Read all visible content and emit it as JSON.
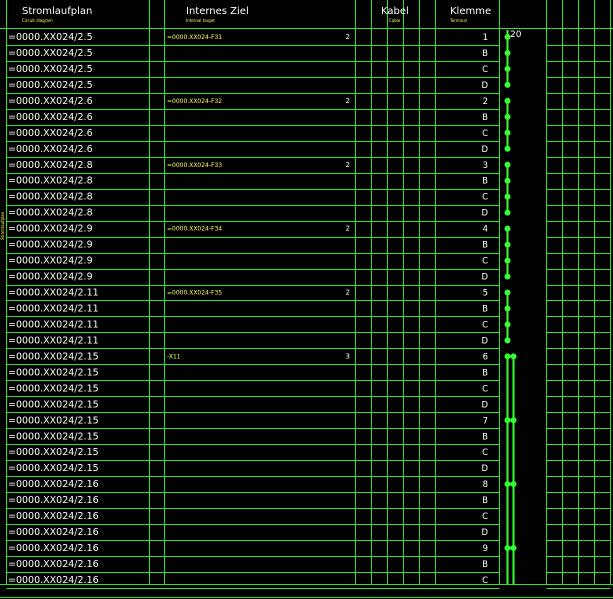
{
  "header": {
    "stromlaufplan": "Stromlaufplan",
    "stromlaufplan_sub": "Circuit diagram",
    "internes_ziel": "Internes Ziel",
    "internes_ziel_sub": "Internal target",
    "kabel": "Kabel",
    "kabel_sub": "Cable",
    "klemme": "Klemme",
    "klemme_sub": "Terminal",
    "bus_label": "20"
  },
  "side_label": "Stromlaufplan",
  "rows": [
    {
      "ref": "=0000.XX024/2.5",
      "target": "=0000.XX024-F31",
      "num": "2",
      "terminal": "1"
    },
    {
      "ref": "=0000.XX024/2.5",
      "target": "",
      "num": "",
      "terminal": "B"
    },
    {
      "ref": "=0000.XX024/2.5",
      "target": "",
      "num": "",
      "terminal": "C"
    },
    {
      "ref": "=0000.XX024/2.5",
      "target": "",
      "num": "",
      "terminal": "D"
    },
    {
      "ref": "=0000.XX024/2.6",
      "target": "=0000.XX024-F32",
      "num": "2",
      "terminal": "2"
    },
    {
      "ref": "=0000.XX024/2.6",
      "target": "",
      "num": "",
      "terminal": "B"
    },
    {
      "ref": "=0000.XX024/2.6",
      "target": "",
      "num": "",
      "terminal": "C"
    },
    {
      "ref": "=0000.XX024/2.6",
      "target": "",
      "num": "",
      "terminal": "D"
    },
    {
      "ref": "=0000.XX024/2.8",
      "target": "=0000.XX024-F33",
      "num": "2",
      "terminal": "3"
    },
    {
      "ref": "=0000.XX024/2.8",
      "target": "",
      "num": "",
      "terminal": "B"
    },
    {
      "ref": "=0000.XX024/2.8",
      "target": "",
      "num": "",
      "terminal": "C"
    },
    {
      "ref": "=0000.XX024/2.8",
      "target": "",
      "num": "",
      "terminal": "D"
    },
    {
      "ref": "=0000.XX024/2.9",
      "target": "=0000.XX024-F34",
      "num": "2",
      "terminal": "4"
    },
    {
      "ref": "=0000.XX024/2.9",
      "target": "",
      "num": "",
      "terminal": "B"
    },
    {
      "ref": "=0000.XX024/2.9",
      "target": "",
      "num": "",
      "terminal": "C"
    },
    {
      "ref": "=0000.XX024/2.9",
      "target": "",
      "num": "",
      "terminal": "D"
    },
    {
      "ref": "=0000.XX024/2.11",
      "target": "=0000.XX024-F35",
      "num": "2",
      "terminal": "5"
    },
    {
      "ref": "=0000.XX024/2.11",
      "target": "",
      "num": "",
      "terminal": "B"
    },
    {
      "ref": "=0000.XX024/2.11",
      "target": "",
      "num": "",
      "terminal": "C"
    },
    {
      "ref": "=0000.XX024/2.11",
      "target": "",
      "num": "",
      "terminal": "D"
    },
    {
      "ref": "=0000.XX024/2.15",
      "target": "-X11",
      "num": "3",
      "terminal": "6"
    },
    {
      "ref": "=0000.XX024/2.15",
      "target": "",
      "num": "",
      "terminal": "B"
    },
    {
      "ref": "=0000.XX024/2.15",
      "target": "",
      "num": "",
      "terminal": "C"
    },
    {
      "ref": "=0000.XX024/2.15",
      "target": "",
      "num": "",
      "terminal": "D"
    },
    {
      "ref": "=0000.XX024/2.15",
      "target": "",
      "num": "",
      "terminal": "7"
    },
    {
      "ref": "=0000.XX024/2.15",
      "target": "",
      "num": "",
      "terminal": "B"
    },
    {
      "ref": "=0000.XX024/2.15",
      "target": "",
      "num": "",
      "terminal": "C"
    },
    {
      "ref": "=0000.XX024/2.15",
      "target": "",
      "num": "",
      "terminal": "D"
    },
    {
      "ref": "=0000.XX024/2.16",
      "target": "",
      "num": "",
      "terminal": "8"
    },
    {
      "ref": "=0000.XX024/2.16",
      "target": "",
      "num": "",
      "terminal": "B"
    },
    {
      "ref": "=0000.XX024/2.16",
      "target": "",
      "num": "",
      "terminal": "C"
    },
    {
      "ref": "=0000.XX024/2.16",
      "target": "",
      "num": "",
      "terminal": "D"
    },
    {
      "ref": "=0000.XX024/2.16",
      "target": "",
      "num": "",
      "terminal": "9"
    },
    {
      "ref": "=0000.XX024/2.16",
      "target": "",
      "num": "",
      "terminal": "B"
    },
    {
      "ref": "=0000.XX024/2.16",
      "target": "",
      "num": "",
      "terminal": "C"
    }
  ],
  "colors": {
    "background": "#000000",
    "grid": "#33e033",
    "text": "#ffffff",
    "target_text": "#ffff66",
    "connection": "#33ff33"
  }
}
